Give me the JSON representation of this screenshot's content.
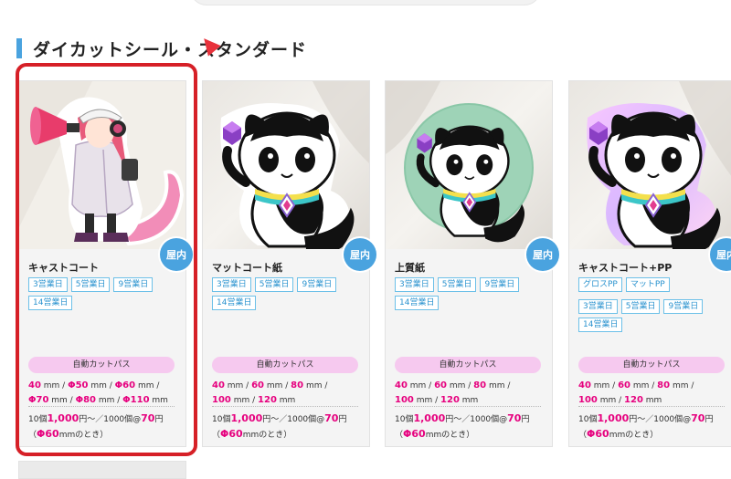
{
  "section": {
    "title": "ダイカットシール・スタンダード"
  },
  "cards": [
    {
      "name": "キャストコート",
      "badge": "屋内",
      "options": [],
      "tags": [
        "3営業日",
        "5営業日",
        "9営業日",
        "14営業日"
      ],
      "cut_label": "自動カットパス",
      "sizes_line1": [
        {
          "v": "40",
          "u": " mm / "
        },
        {
          "v": "Φ50",
          "u": " mm / "
        },
        {
          "v": "Φ60",
          "u": " mm /"
        }
      ],
      "sizes_line2": [
        {
          "v": "Φ70",
          "u": " mm / "
        },
        {
          "v": "Φ80",
          "u": " mm / "
        },
        {
          "v": "Φ110",
          "u": " mm"
        }
      ],
      "price": {
        "pre": "10個",
        "p1": "1,000",
        "mid": "円〜／1000個@",
        "p2": "70",
        "post": "円",
        "note_pre": "（",
        "note_v": "Φ60",
        "note_post": "mmのとき）"
      },
      "image": "character-megaphone-sticker"
    },
    {
      "name": "マットコート紙",
      "badge": "屋内",
      "options": [],
      "tags": [
        "3営業日",
        "5営業日",
        "9営業日",
        "14営業日"
      ],
      "cut_label": "自動カットパス",
      "sizes_line1": [
        {
          "v": "40",
          "u": " mm / "
        },
        {
          "v": "60",
          "u": " mm / "
        },
        {
          "v": "80",
          "u": " mm /"
        }
      ],
      "sizes_line2": [
        {
          "v": "100",
          "u": " mm / "
        },
        {
          "v": "120",
          "u": " mm"
        }
      ],
      "price": {
        "pre": "10個",
        "p1": "1,000",
        "mid": "円〜／1000個@",
        "p2": "70",
        "post": "円",
        "note_pre": "（",
        "note_v": "Φ60",
        "note_post": "mmのとき）"
      },
      "image": "panda-cat-sticker"
    },
    {
      "name": "上質紙",
      "badge": "屋内",
      "options": [],
      "tags": [
        "3営業日",
        "5営業日",
        "9営業日",
        "14営業日"
      ],
      "cut_label": "自動カットパス",
      "sizes_line1": [
        {
          "v": "40",
          "u": " mm / "
        },
        {
          "v": "60",
          "u": " mm / "
        },
        {
          "v": "80",
          "u": " mm /"
        }
      ],
      "sizes_line2": [
        {
          "v": "100",
          "u": " mm / "
        },
        {
          "v": "120",
          "u": " mm"
        }
      ],
      "price": {
        "pre": "10個",
        "p1": "1,000",
        "mid": "円〜／1000個@",
        "p2": "70",
        "post": "円",
        "note_pre": "（",
        "note_v": "Φ60",
        "note_post": "mmのとき）"
      },
      "image": "panda-cat-round-sticker"
    },
    {
      "name": "キャストコート+PP",
      "badge": "屋内",
      "options": [
        "グロスPP",
        "マットPP"
      ],
      "tags": [
        "3営業日",
        "5営業日",
        "9営業日",
        "14営業日"
      ],
      "cut_label": "自動カットパス",
      "sizes_line1": [
        {
          "v": "40",
          "u": " mm / "
        },
        {
          "v": "60",
          "u": " mm / "
        },
        {
          "v": "80",
          "u": " mm /"
        }
      ],
      "sizes_line2": [
        {
          "v": "100",
          "u": " mm / "
        },
        {
          "v": "120",
          "u": " mm"
        }
      ],
      "price": {
        "pre": "10個",
        "p1": "1,000",
        "mid": "円〜／1000個@",
        "p2": "70",
        "post": "円",
        "note_pre": "（",
        "note_v": "Φ60",
        "note_post": "mmのとき）"
      },
      "image": "panda-cat-holo-sticker"
    }
  ],
  "colors": {
    "accent": "#4aa3df",
    "price": "#e6007e",
    "highlight": "#d62027",
    "cut_bg": "#f6c9ef"
  }
}
